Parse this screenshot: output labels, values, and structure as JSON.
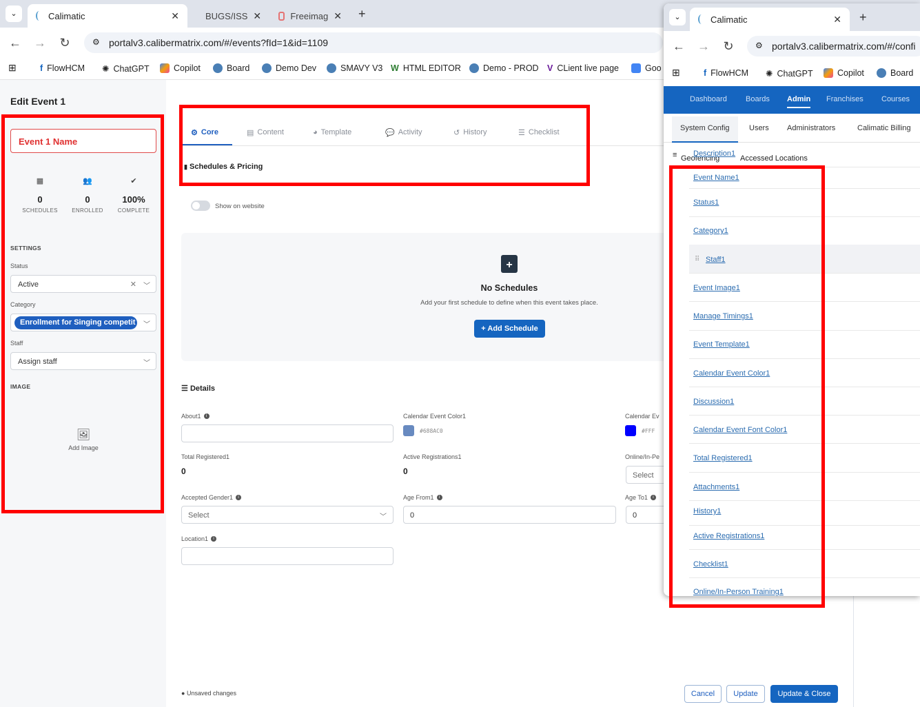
{
  "browser": {
    "tabs": [
      {
        "title": "Calimatic"
      },
      {
        "title": "BUGS/ISS"
      },
      {
        "title": "Freeimag"
      }
    ],
    "url": "portalv3.calibermatrix.com/#/events?fId=1&id=1109",
    "bookmarks": [
      "FlowHCM",
      "ChatGPT",
      "Copilot",
      "Board",
      "Demo Dev",
      "SMAVY V3",
      "HTML EDITOR",
      "Demo - PROD",
      "CLient live page",
      "Goo"
    ]
  },
  "page": {
    "title": "Edit Event 1",
    "event_name": "Event 1 Name",
    "stats": [
      {
        "value": "0",
        "label": "SCHEDULES",
        "icon": "calendar-icon"
      },
      {
        "value": "0",
        "label": "ENROLLED",
        "icon": "users-icon"
      },
      {
        "value": "100%",
        "label": "COMPLETE",
        "icon": "check-circle-icon"
      }
    ],
    "settings_label": "SETTINGS",
    "status_label": "Status",
    "status_value": "Active",
    "category_label": "Category",
    "category_value": "Enrollment for Singing competit",
    "staff_label": "Staff",
    "staff_placeholder": "Assign staff",
    "image_label": "IMAGE",
    "add_image": "Add Image",
    "tabs": [
      "Core",
      "Content",
      "Template",
      "Activity",
      "History",
      "Checklist"
    ],
    "schedules_header": "Schedules & Pricing",
    "show_on_website": "Show on website",
    "no_schedules_title": "No Schedules",
    "no_schedules_desc": "Add your first schedule to define when this event takes place.",
    "add_schedule": "Add Schedule",
    "details_header": "Details",
    "fields": {
      "about_label": "About1",
      "cal_color_label": "Calendar Event Color1",
      "cal_color_hex": "#688AC0",
      "cal_font_label": "Calendar Ev",
      "cal_font_hex": "#FFF",
      "total_reg_label": "Total Registered1",
      "total_reg_value": "0",
      "active_reg_label": "Active Registrations1",
      "active_reg_value": "0",
      "online_label": "Online/In-Pe",
      "online_placeholder": "Select",
      "gender_label": "Accepted Gender1",
      "gender_placeholder": "Select",
      "age_from_label": "Age From1",
      "age_from_value": "0",
      "age_to_label": "Age To1",
      "age_to_value": "0",
      "location_label": "Location1"
    },
    "unsaved": "Unsaved changes",
    "cancel": "Cancel",
    "update": "Update",
    "update_close": "Update & Close",
    "colors": {
      "cal_color": "#688AC0",
      "cal_font_color": "#0000FF"
    }
  },
  "popup": {
    "tab_title": "Calimatic",
    "url": "portalv3.calibermatrix.com/#/confi",
    "bookmarks": [
      "FlowHCM",
      "ChatGPT",
      "Copilot",
      "Board"
    ],
    "nav": [
      "Dashboard",
      "Boards",
      "Admin",
      "Franchises",
      "Courses"
    ],
    "subnav": [
      "System Config",
      "Users",
      "Administrators",
      "Calimatic Billing"
    ],
    "side_items": [
      "Geofencing",
      "Accessed Locations"
    ],
    "items": [
      "Description1",
      "Event Name1",
      "Status1",
      "Category1",
      "Staff1",
      "Event Image1",
      "Manage Timings1",
      "Event Template1",
      "Calendar Event Color1",
      "Discussion1",
      "Calendar Event Font Color1",
      "Total Registered1",
      "Attachments1",
      "History1",
      "Active Registrations1",
      "Checklist1",
      "Online/In-Person Training1"
    ]
  }
}
